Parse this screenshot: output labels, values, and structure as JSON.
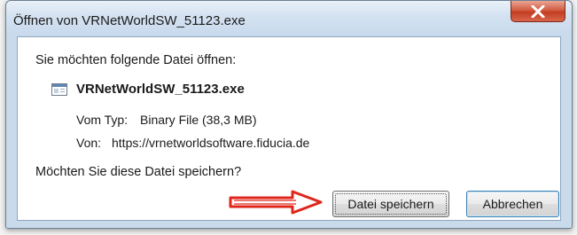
{
  "dialog": {
    "title": "Öffnen von VRNetWorldSW_51123.exe",
    "close_icon": "close-icon",
    "question": "Sie möchten folgende Datei öffnen:",
    "file": {
      "icon": "executable-file-icon",
      "name": "VRNetWorldSW_51123.exe",
      "type_label": "Vom Typ:",
      "type_value": "Binary File (38,3 MB)",
      "from_label": "Von:",
      "from_value": "https://vrnetworldsoftware.fiducia.de"
    },
    "save_question": "Möchten Sie diese Datei speichern?",
    "buttons": {
      "save_label": "Datei speichern",
      "cancel_label": "Abbrechen"
    },
    "annotation": {
      "icon": "red-arrow-icon",
      "color": "#e0261b"
    }
  }
}
